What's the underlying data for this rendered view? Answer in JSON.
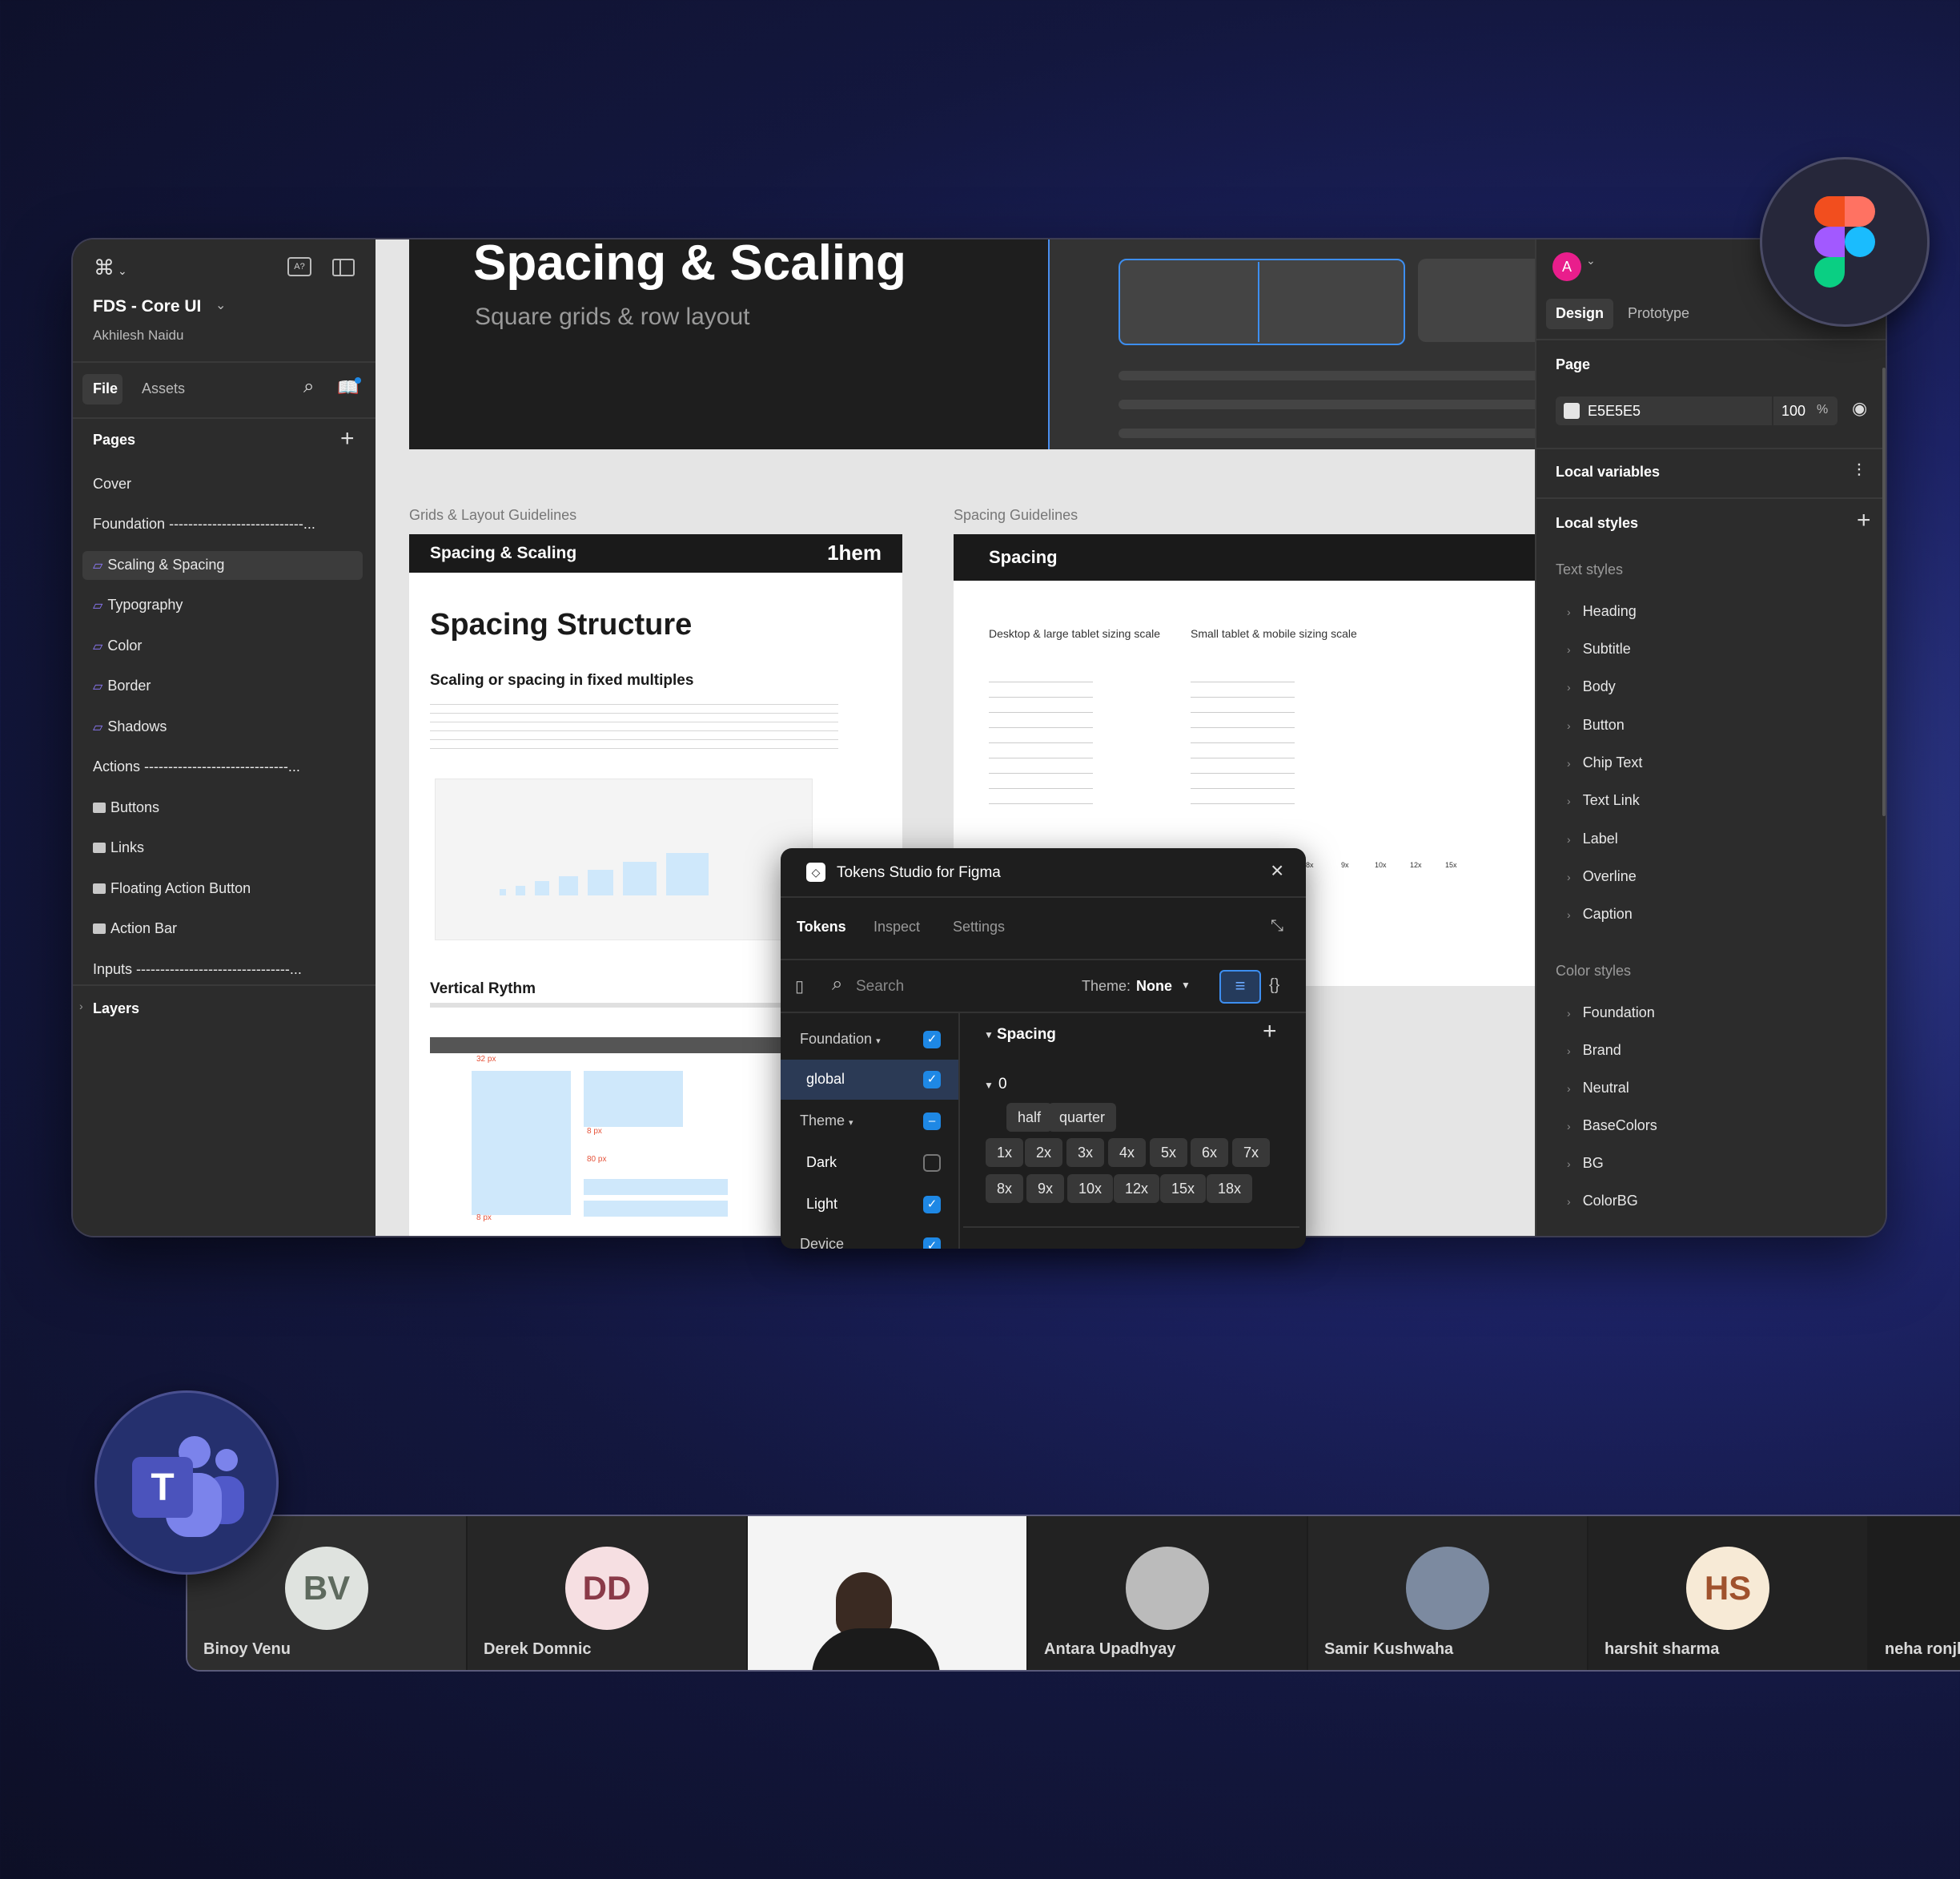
{
  "left_panel": {
    "file_name": "FDS - Core UI",
    "owner": "Akhilesh Naidu",
    "tabs": [
      "File",
      "Assets"
    ],
    "pages_title": "Pages",
    "pages": [
      {
        "label": "Cover",
        "icon": ""
      },
      {
        "label": "Foundation ----------------------------...",
        "icon": ""
      },
      {
        "label": "Scaling & Spacing",
        "icon": "ruler-icon"
      },
      {
        "label": "Typography",
        "icon": "ruler-icon"
      },
      {
        "label": "Color",
        "icon": "ruler-icon"
      },
      {
        "label": "Border",
        "icon": "ruler-icon"
      },
      {
        "label": "Shadows",
        "icon": "ruler-icon"
      },
      {
        "label": "Actions ------------------------------...",
        "icon": ""
      },
      {
        "label": "Buttons",
        "icon": "ok-icon"
      },
      {
        "label": "Links",
        "icon": "ok-icon"
      },
      {
        "label": "Floating Action Button",
        "icon": "ok-icon"
      },
      {
        "label": "Action Bar",
        "icon": "ok-icon"
      },
      {
        "label": "Inputs --------------------------------...",
        "icon": ""
      }
    ],
    "layers_label": "Layers"
  },
  "canvas": {
    "hero_title": "Spacing & Scaling",
    "hero_subtitle": "Square grids & row layout",
    "section_left_label": "Grids & Layout Guidelines",
    "section_right_label": "Spacing Guidelines",
    "card_left_header": "Spacing & Scaling",
    "card_left_brand": "1hem",
    "structure_title": "Spacing Structure",
    "fixed_title": "Scaling or spacing in fixed multiples",
    "vertical_title": "Vertical Rythm",
    "card_right_header": "Spacing",
    "desktop_scale": "Desktop & large tablet sizing scale",
    "mobile_scale": "Small tablet & mobile sizing scale",
    "bar_labels": [
      "8x",
      "9x",
      "10x",
      "12x",
      "15x"
    ],
    "measure_labels": [
      "32 px",
      "8 px",
      "80 px",
      "8 px"
    ]
  },
  "plugin": {
    "title": "Tokens Studio for Figma",
    "tabs": [
      "Tokens",
      "Inspect",
      "Settings"
    ],
    "search_placeholder": "Search",
    "theme_label": "Theme:",
    "theme_value": "None",
    "sets": [
      {
        "label": "Foundation",
        "checked": "on"
      },
      {
        "label": "global",
        "checked": "on"
      },
      {
        "label": "Theme",
        "checked": "partial"
      },
      {
        "label": "Dark",
        "checked": "off"
      },
      {
        "label": "Light",
        "checked": "on"
      },
      {
        "label": "Device",
        "checked": "on"
      }
    ],
    "group_title": "Spacing",
    "subgroup": "0",
    "chips_row1": [
      "half",
      "quarter"
    ],
    "chips_row2": [
      "1x",
      "2x",
      "3x",
      "4x",
      "5x",
      "6x",
      "7x"
    ],
    "chips_row3": [
      "8x",
      "9x",
      "10x",
      "12x",
      "15x",
      "18x"
    ]
  },
  "right_panel": {
    "avatar_letter": "A",
    "tabs": [
      "Design",
      "Prototype"
    ],
    "page_label": "Page",
    "page_color": "E5E5E5",
    "page_opacity": "100",
    "opacity_unit": "%",
    "local_variables": "Local variables",
    "local_styles": "Local styles",
    "text_styles_label": "Text styles",
    "text_styles": [
      "Heading",
      "Subtitle",
      "Body",
      "Button",
      "Chip Text",
      "Text Link",
      "Label",
      "Overline",
      "Caption"
    ],
    "color_styles_label": "Color styles",
    "color_styles": [
      "Foundation",
      "Brand",
      "Neutral",
      "BaseColors",
      "BG",
      "ColorBG"
    ]
  },
  "teams": {
    "participants": [
      {
        "initials": "BV",
        "name": "Binoy Venu",
        "bg": "#dfe3df",
        "fg": "#5e6a5e"
      },
      {
        "initials": "DD",
        "name": "Derek Domnic",
        "bg": "#f6dfe2",
        "fg": "#8a3a48"
      },
      {
        "initials": "",
        "name": "",
        "bg": "#ffffff",
        "fg": "#000000"
      },
      {
        "initials": "",
        "name": "Antara Upadhyay",
        "bg": "#bbbbbb",
        "fg": "#000000"
      },
      {
        "initials": "",
        "name": "Samir Kushwaha",
        "bg": "#7c8aa0",
        "fg": "#000000"
      },
      {
        "initials": "HS",
        "name": "harshit sharma",
        "bg": "#f7ead6",
        "fg": "#a0522d"
      },
      {
        "initials": "",
        "name": "neha ronjh",
        "bg": "#2a2a2a",
        "fg": "#000000"
      }
    ]
  },
  "colors": {
    "accent": "#1e88e5",
    "figma_bg": "#2c2c2c",
    "canvas_bg": "#e5e5e5"
  }
}
